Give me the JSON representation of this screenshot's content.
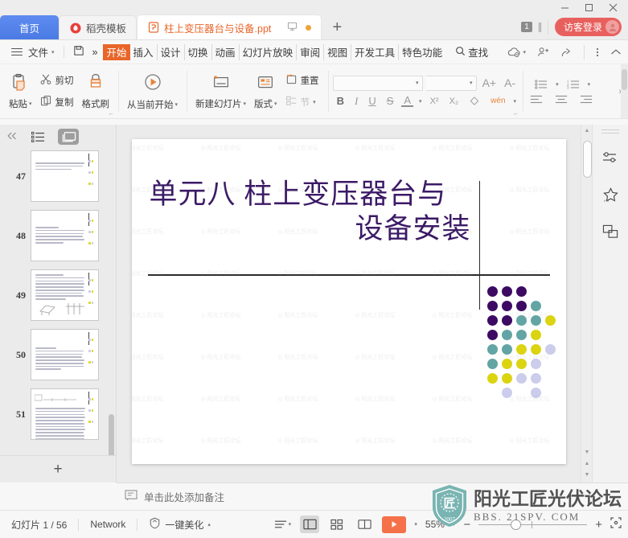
{
  "window": {
    "controls": [
      "minimize",
      "maximize",
      "close"
    ]
  },
  "tabs": {
    "home_label": "首页",
    "items": [
      {
        "label": "稻壳模板",
        "icon": "docer-icon",
        "state": "inactive"
      },
      {
        "label": "柱上变压器台与设备.ppt",
        "icon": "ppt-file-icon",
        "state": "active"
      }
    ],
    "new_tab_label": "+",
    "page_badge": "1",
    "login_label": "访客登录"
  },
  "menubar": {
    "file_label": "文件",
    "save_icon": "save-icon",
    "more_icon": "chevron-double-right-icon",
    "ribbon_tabs": [
      {
        "label": "开始",
        "selected": true
      },
      {
        "label": "插入",
        "selected": false
      },
      {
        "label": "设计",
        "selected": false
      },
      {
        "label": "切换",
        "selected": false
      },
      {
        "label": "动画",
        "selected": false
      },
      {
        "label": "幻灯片放映",
        "selected": false
      },
      {
        "label": "审阅",
        "selected": false
      },
      {
        "label": "视图",
        "selected": false
      },
      {
        "label": "开发工具",
        "selected": false
      },
      {
        "label": "特色功能",
        "selected": false
      }
    ],
    "find_label": "查找",
    "right_icons": [
      "cloud-sync-icon",
      "add-user-icon",
      "share-icon",
      "more-vertical-icon",
      "collapse-ribbon-icon"
    ]
  },
  "ribbon": {
    "clipboard": {
      "paste_label": "粘贴",
      "cut_label": "剪切",
      "copy_label": "复制",
      "format_painter_label": "格式刷"
    },
    "slideshow": {
      "from_current_label": "从当前开始"
    },
    "slides": {
      "new_slide_label": "新建幻灯片",
      "layout_label": "版式",
      "section_label": "节",
      "reset_label": "重置"
    },
    "font": {
      "font_name_value": "",
      "font_size_value": "",
      "grow_font": "A+",
      "shrink_font": "A-",
      "bold": "B",
      "italic": "I",
      "underline": "U",
      "strikethrough": "S",
      "font_color": "A",
      "superscript": "X²",
      "subscript": "X₂",
      "clear_format": "clear-format-icon",
      "pinyin_label": "wén"
    },
    "paragraph": {
      "bullets_icon": "bullet-list-icon",
      "numbering_icon": "numbered-list-icon",
      "align_left_icon": "align-left-icon",
      "align_center_icon": "align-center-icon",
      "align_right_icon": "align-right-icon"
    },
    "overflow_label": "›"
  },
  "thumbnails": {
    "collapse_icon": "collapse-left-icon",
    "outline_view_icon": "outline-view-icon",
    "slide_view_icon": "slide-view-icon",
    "add_slide_label": "+",
    "items": [
      {
        "number": "47",
        "lines": 3
      },
      {
        "number": "48",
        "lines": 6
      },
      {
        "number": "49",
        "lines": 9
      },
      {
        "number": "50",
        "lines": 8
      },
      {
        "number": "51",
        "lines": 14
      }
    ]
  },
  "slide": {
    "title_line1": "单元八  柱上变压器台与",
    "title_line2": "设备安装",
    "title_color": "#3b1a66",
    "watermark_text": "阳光工匠论坛",
    "dot_palette": {
      "purple": "#3d0a63",
      "teal": "#63a4a4",
      "yellow": "#dbd411",
      "lavender": "#ccccec"
    },
    "dot_grid": [
      [
        "purple",
        "purple",
        "purple",
        "",
        ""
      ],
      [
        "purple",
        "purple",
        "purple",
        "teal",
        ""
      ],
      [
        "purple",
        "purple",
        "teal",
        "teal",
        "yellow"
      ],
      [
        "purple",
        "teal",
        "teal",
        "yellow",
        ""
      ],
      [
        "teal",
        "teal",
        "yellow",
        "yellow",
        "lavender"
      ],
      [
        "teal",
        "yellow",
        "yellow",
        "lavender",
        ""
      ],
      [
        "yellow",
        "yellow",
        "lavender",
        "lavender",
        ""
      ],
      [
        "",
        "lavender",
        "",
        "lavender",
        ""
      ]
    ]
  },
  "right_rail": {
    "items": [
      {
        "icon": "sliders-icon",
        "name": "properties"
      },
      {
        "icon": "magic-star-icon",
        "name": "beautify"
      },
      {
        "icon": "duplicate-shapes-icon",
        "name": "shapes"
      }
    ]
  },
  "notes": {
    "icon": "notes-icon",
    "placeholder": "单击此处添加备注"
  },
  "status": {
    "slide_counter": "幻灯片 1 / 56",
    "network_label": "Network",
    "beautify_label": "一键美化",
    "view_buttons": [
      {
        "icon": "view-options-icon",
        "selected": false
      },
      {
        "icon": "normal-view-icon",
        "selected": true
      },
      {
        "icon": "slide-sorter-icon",
        "selected": false
      },
      {
        "icon": "reading-view-icon",
        "selected": false
      }
    ],
    "play_icon": "play-icon",
    "zoom_value": "55%",
    "zoom_minus": "−",
    "zoom_plus": "+",
    "fit_icon": "fit-to-window-icon"
  },
  "watermark": {
    "cn_text": "阳光工匠光伏论坛",
    "en_text": "BBS. 21SPV. COM",
    "badge_year": "2007",
    "color": "#69aead"
  }
}
